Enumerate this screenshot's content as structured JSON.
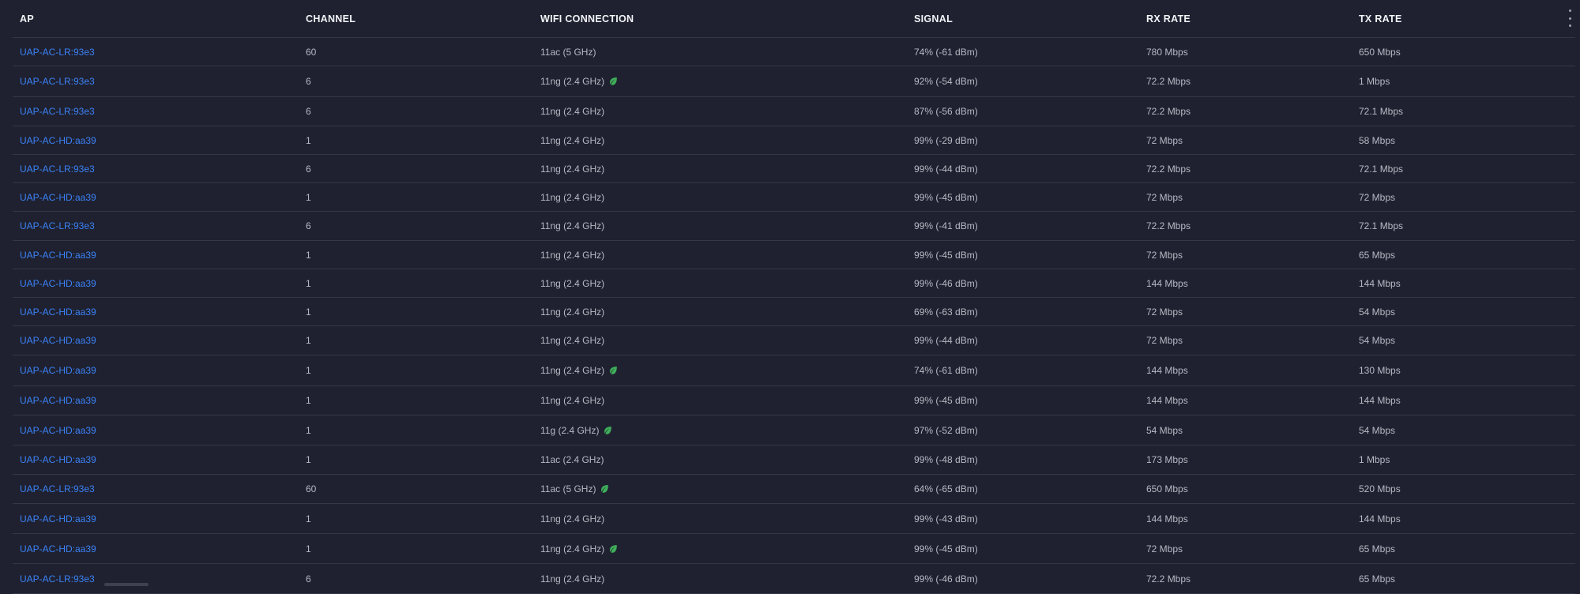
{
  "headers": {
    "ap": "AP",
    "channel": "CHANNEL",
    "wifi": "WIFI CONNECTION",
    "signal": "SIGNAL",
    "rx": "RX RATE",
    "tx": "TX RATE"
  },
  "colors": {
    "link": "#3b82f6",
    "leaf": "#3fae5a",
    "background": "#1f2130"
  },
  "icons": {
    "menu": "more-vertical-icon",
    "eco": "leaf-icon"
  },
  "rows": [
    {
      "ap": "UAP-AC-LR:93e3",
      "channel": "60",
      "wifi": "11ac (5 GHz)",
      "leaf": false,
      "signal": "74% (-61 dBm)",
      "rx": "780 Mbps",
      "tx": "650 Mbps"
    },
    {
      "ap": "UAP-AC-LR:93e3",
      "channel": "6",
      "wifi": "11ng (2.4 GHz)",
      "leaf": true,
      "signal": "92% (-54 dBm)",
      "rx": "72.2 Mbps",
      "tx": "1 Mbps"
    },
    {
      "ap": "UAP-AC-LR:93e3",
      "channel": "6",
      "wifi": "11ng (2.4 GHz)",
      "leaf": false,
      "signal": "87% (-56 dBm)",
      "rx": "72.2 Mbps",
      "tx": "72.1 Mbps"
    },
    {
      "ap": "UAP-AC-HD:aa39",
      "channel": "1",
      "wifi": "11ng (2.4 GHz)",
      "leaf": false,
      "signal": "99% (-29 dBm)",
      "rx": "72 Mbps",
      "tx": "58 Mbps"
    },
    {
      "ap": "UAP-AC-LR:93e3",
      "channel": "6",
      "wifi": "11ng (2.4 GHz)",
      "leaf": false,
      "signal": "99% (-44 dBm)",
      "rx": "72.2 Mbps",
      "tx": "72.1 Mbps"
    },
    {
      "ap": "UAP-AC-HD:aa39",
      "channel": "1",
      "wifi": "11ng (2.4 GHz)",
      "leaf": false,
      "signal": "99% (-45 dBm)",
      "rx": "72 Mbps",
      "tx": "72 Mbps"
    },
    {
      "ap": "UAP-AC-LR:93e3",
      "channel": "6",
      "wifi": "11ng (2.4 GHz)",
      "leaf": false,
      "signal": "99% (-41 dBm)",
      "rx": "72.2 Mbps",
      "tx": "72.1 Mbps"
    },
    {
      "ap": "UAP-AC-HD:aa39",
      "channel": "1",
      "wifi": "11ng (2.4 GHz)",
      "leaf": false,
      "signal": "99% (-45 dBm)",
      "rx": "72 Mbps",
      "tx": "65 Mbps"
    },
    {
      "ap": "UAP-AC-HD:aa39",
      "channel": "1",
      "wifi": "11ng (2.4 GHz)",
      "leaf": false,
      "signal": "99% (-46 dBm)",
      "rx": "144 Mbps",
      "tx": "144 Mbps"
    },
    {
      "ap": "UAP-AC-HD:aa39",
      "channel": "1",
      "wifi": "11ng (2.4 GHz)",
      "leaf": false,
      "signal": "69% (-63 dBm)",
      "rx": "72 Mbps",
      "tx": "54 Mbps"
    },
    {
      "ap": "UAP-AC-HD:aa39",
      "channel": "1",
      "wifi": "11ng (2.4 GHz)",
      "leaf": false,
      "signal": "99% (-44 dBm)",
      "rx": "72 Mbps",
      "tx": "54 Mbps"
    },
    {
      "ap": "UAP-AC-HD:aa39",
      "channel": "1",
      "wifi": "11ng (2.4 GHz)",
      "leaf": true,
      "signal": "74% (-61 dBm)",
      "rx": "144 Mbps",
      "tx": "130 Mbps"
    },
    {
      "ap": "UAP-AC-HD:aa39",
      "channel": "1",
      "wifi": "11ng (2.4 GHz)",
      "leaf": false,
      "signal": "99% (-45 dBm)",
      "rx": "144 Mbps",
      "tx": "144 Mbps"
    },
    {
      "ap": "UAP-AC-HD:aa39",
      "channel": "1",
      "wifi": "11g (2.4 GHz)",
      "leaf": true,
      "signal": "97% (-52 dBm)",
      "rx": "54 Mbps",
      "tx": "54 Mbps"
    },
    {
      "ap": "UAP-AC-HD:aa39",
      "channel": "1",
      "wifi": "11ac (2.4 GHz)",
      "leaf": false,
      "signal": "99% (-48 dBm)",
      "rx": "173 Mbps",
      "tx": "1 Mbps"
    },
    {
      "ap": "UAP-AC-LR:93e3",
      "channel": "60",
      "wifi": "11ac (5 GHz)",
      "leaf": true,
      "signal": "64% (-65 dBm)",
      "rx": "650 Mbps",
      "tx": "520 Mbps"
    },
    {
      "ap": "UAP-AC-HD:aa39",
      "channel": "1",
      "wifi": "11ng (2.4 GHz)",
      "leaf": false,
      "signal": "99% (-43 dBm)",
      "rx": "144 Mbps",
      "tx": "144 Mbps"
    },
    {
      "ap": "UAP-AC-HD:aa39",
      "channel": "1",
      "wifi": "11ng (2.4 GHz)",
      "leaf": true,
      "signal": "99% (-45 dBm)",
      "rx": "72 Mbps",
      "tx": "65 Mbps"
    },
    {
      "ap": "UAP-AC-LR:93e3",
      "channel": "6",
      "wifi": "11ng (2.4 GHz)",
      "leaf": false,
      "signal": "99% (-46 dBm)",
      "rx": "72.2 Mbps",
      "tx": "65 Mbps"
    }
  ]
}
